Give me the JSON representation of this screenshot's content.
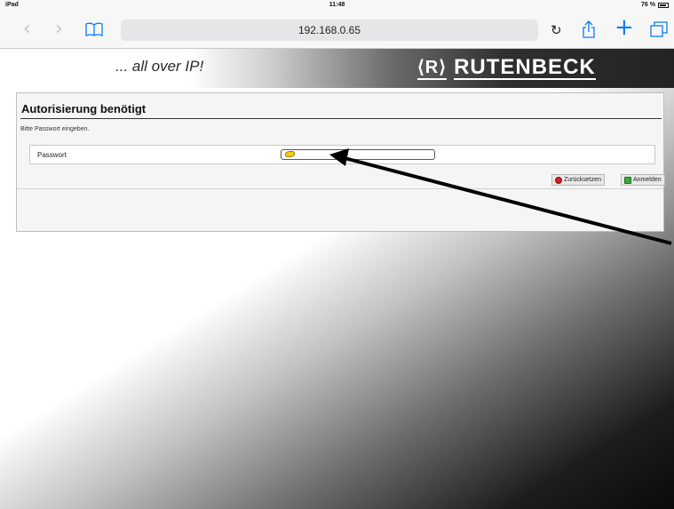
{
  "status_bar": {
    "device": "iPad",
    "time": "11:48",
    "battery": "76 %"
  },
  "browser": {
    "url": "192.168.0.65",
    "icons": [
      "back-icon",
      "forward-icon",
      "bookmarks-icon",
      "reload-icon",
      "share-icon",
      "new-tab-icon",
      "tabs-icon"
    ]
  },
  "brand": {
    "slogan": "... all over IP!",
    "logo_mark": "⟨R⟩",
    "logo_text": "RUTENBECK"
  },
  "login": {
    "title": "Autorisierung benötigt",
    "hint": "Bitte Passwort eingeben.",
    "password_label": "Passwort",
    "password_value": "",
    "reset_label": "Zurücksetzen",
    "login_label": "Anmelden"
  },
  "colors": {
    "accent": "#0a7cf6",
    "reset_icon": "#d32020",
    "login_icon": "#3da93d",
    "key_icon": "#f3c81a"
  }
}
